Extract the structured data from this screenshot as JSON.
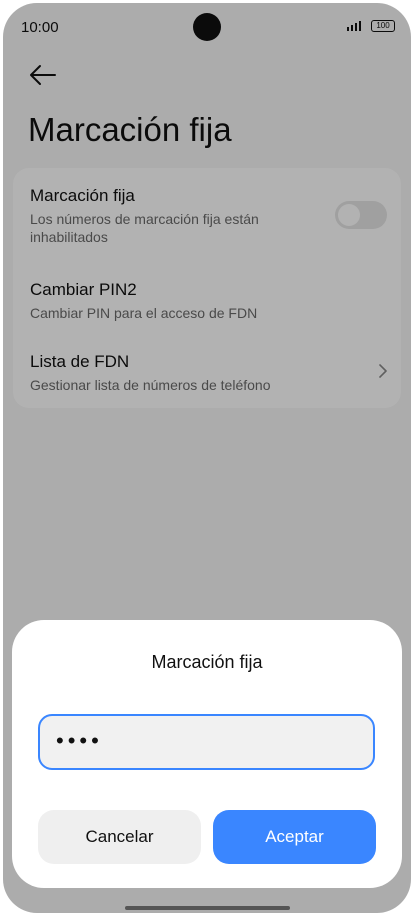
{
  "status_bar": {
    "time": "10:00",
    "battery": "100",
    "icons": [
      "signal-icon",
      "battery-icon"
    ]
  },
  "app": {
    "back_icon": "back-arrow-icon",
    "title": "Marcación fija"
  },
  "settings": {
    "items": [
      {
        "title": "Marcación fija",
        "subtitle_lines": [
          "Los números de marcación fija están",
          "inhabilitados"
        ],
        "control": "toggle",
        "toggle_on": false
      },
      {
        "title": "Cambiar PIN2",
        "subtitle_lines": [
          "Cambiar PIN para el acceso de FDN"
        ]
      },
      {
        "title": "Lista de FDN",
        "subtitle_lines": [
          "Gestionar lista de números de teléfono"
        ],
        "control": "chevron-right-icon"
      }
    ]
  },
  "dialog": {
    "title": "Marcación fija",
    "input_value": "••••",
    "cancel_label": "Cancelar",
    "accept_label": "Aceptar"
  },
  "colors": {
    "accent": "#3a86ff",
    "scrim": "#000000"
  }
}
